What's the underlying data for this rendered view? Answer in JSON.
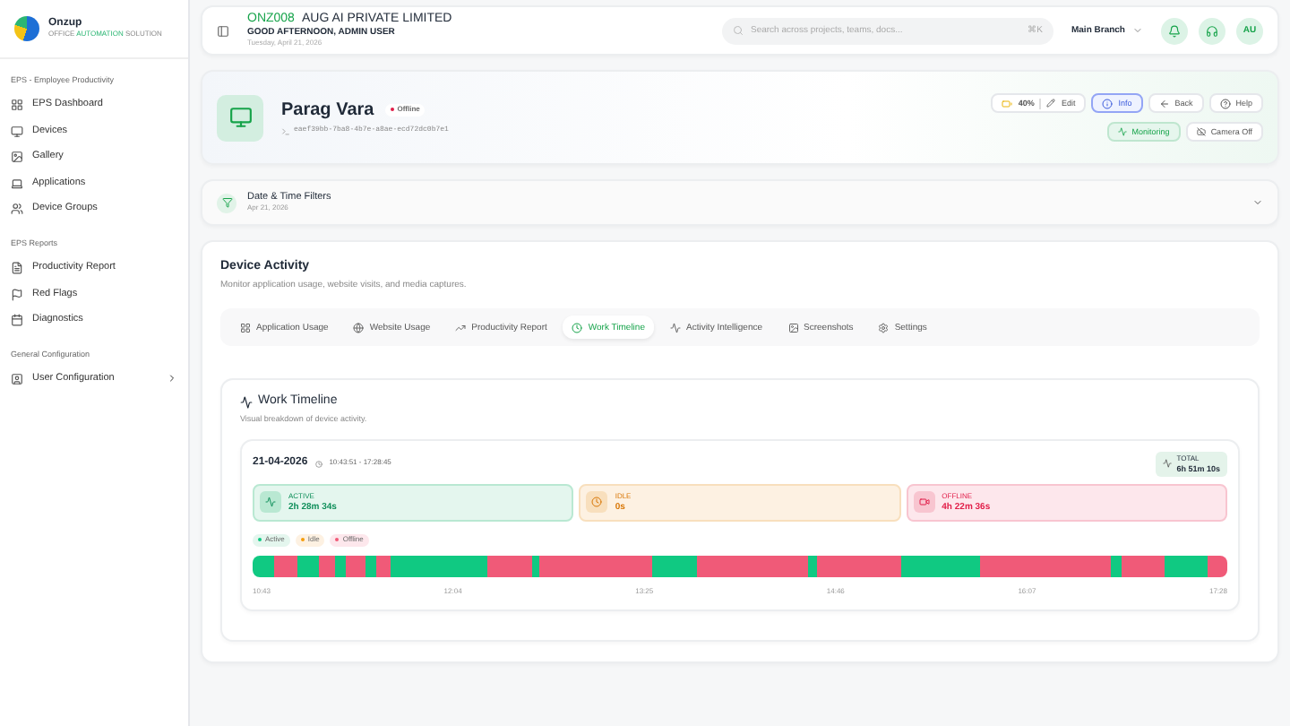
{
  "brand": {
    "name": "Onzup",
    "tagline_1": "OFFICE",
    "tagline_2": "AUTOMATION",
    "tagline_3": "SOLUTION"
  },
  "sidebar": {
    "sections": [
      {
        "title": "EPS - Employee Productivity",
        "items": [
          {
            "label": "EPS Dashboard"
          },
          {
            "label": "Devices"
          },
          {
            "label": "Gallery"
          },
          {
            "label": "Applications"
          },
          {
            "label": "Device Groups"
          }
        ]
      },
      {
        "title": "EPS Reports",
        "items": [
          {
            "label": "Productivity Report"
          },
          {
            "label": "Red Flags"
          },
          {
            "label": "Diagnostics"
          }
        ]
      },
      {
        "title": "General Configuration",
        "items": [
          {
            "label": "User Configuration"
          }
        ]
      }
    ]
  },
  "header": {
    "code": "ONZ008",
    "company": "AUG AI PRIVATE LIMITED",
    "greeting": "GOOD AFTERNOON, ADMIN USER",
    "date": "Tuesday, April 21, 2026",
    "search": {
      "placeholder": "Search across projects, teams, docs..."
    },
    "shortcut": "⌘K",
    "branch": "Main Branch",
    "avatar": "AU"
  },
  "device": {
    "name": "Parag Vara",
    "status": "Offline",
    "id": "eaef39bb-7ba8-4b7e-a8ae-ecd72dc0b7e1",
    "battery": "40%",
    "edit": "Edit",
    "actions": [
      {
        "label": "Info",
        "selected": true
      },
      {
        "label": "Back",
        "selected": false
      },
      {
        "label": "Help",
        "selected": false
      }
    ],
    "monitoring": "Monitoring",
    "camera": "Camera Off"
  },
  "filters": {
    "title": "Date & Time Filters",
    "date": "Apr 21, 2026"
  },
  "activity": {
    "title": "Device Activity",
    "subtitle": "Monitor application usage, website visits, and media captures.",
    "tabs": [
      {
        "label": "Application Usage",
        "selected": false
      },
      {
        "label": "Website Usage",
        "selected": false
      },
      {
        "label": "Productivity Report",
        "selected": false
      },
      {
        "label": "Work Timeline",
        "selected": true
      },
      {
        "label": "Activity Intelligence",
        "selected": false
      },
      {
        "label": "Screenshots",
        "selected": false
      },
      {
        "label": "Settings",
        "selected": false
      }
    ]
  },
  "timeline": {
    "title": "Work Timeline",
    "subtitle": "Visual breakdown of device activity.",
    "date": "21-04-2026",
    "range": "10:43:51 - 17:28:45",
    "total_label": "TOTAL",
    "total": "6h 51m 10s",
    "stats": [
      {
        "kind": "active",
        "label": "ACTIVE",
        "value": "2h 28m 34s"
      },
      {
        "kind": "idle",
        "label": "IDLE",
        "value": "0s"
      },
      {
        "kind": "offline",
        "label": "OFFLINE",
        "value": "4h 22m 36s"
      }
    ],
    "legend": [
      {
        "kind": "active",
        "label": "Active"
      },
      {
        "kind": "idle",
        "label": "Idle"
      },
      {
        "kind": "offline",
        "label": "Offline"
      }
    ],
    "ticks": [
      "10:43",
      "12:04",
      "13:25",
      "14:46",
      "16:07",
      "17:28"
    ]
  }
}
